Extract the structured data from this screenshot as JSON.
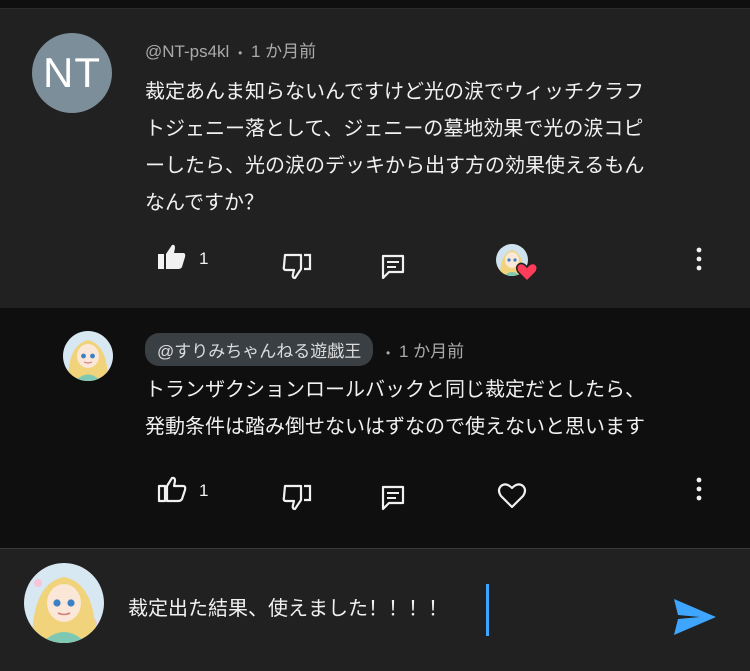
{
  "comment": {
    "avatar_initials": "NT",
    "author": "@NT-ps4kl",
    "separator": "•",
    "time": "1 か月前",
    "lines": [
      "裁定あんま知らないんですけど光の涙でウィッチクラフ",
      "トジェニー落として、ジェニーの墓地効果で光の涙コピ",
      "ーしたら、光の涙のデッキから出す方の効果使えるもん",
      "なんですか？"
    ],
    "like_count": "1",
    "icons": [
      "thumbs-up-filled",
      "thumbs-down",
      "reply",
      "creator-heart",
      "more-vertical"
    ]
  },
  "reply": {
    "author": "@すりみちゃんねる遊戯王",
    "separator": "•",
    "time": "1 か月前",
    "lines": [
      "トランザクションロールバックと同じ裁定だとしたら、",
      "発動条件は踏み倒せないはずなので使えないと思います"
    ],
    "like_count": "1",
    "icons": [
      "thumbs-up",
      "thumbs-down",
      "reply",
      "heart-outline",
      "more-vertical"
    ]
  },
  "composer": {
    "value": "裁定出た結果、使えました！！！！",
    "icons": [
      "send"
    ]
  },
  "colors": {
    "accent": "#3ea6ff",
    "heart": "#ff3c5a",
    "surface": "#212121",
    "background": "#0f0f0f"
  }
}
